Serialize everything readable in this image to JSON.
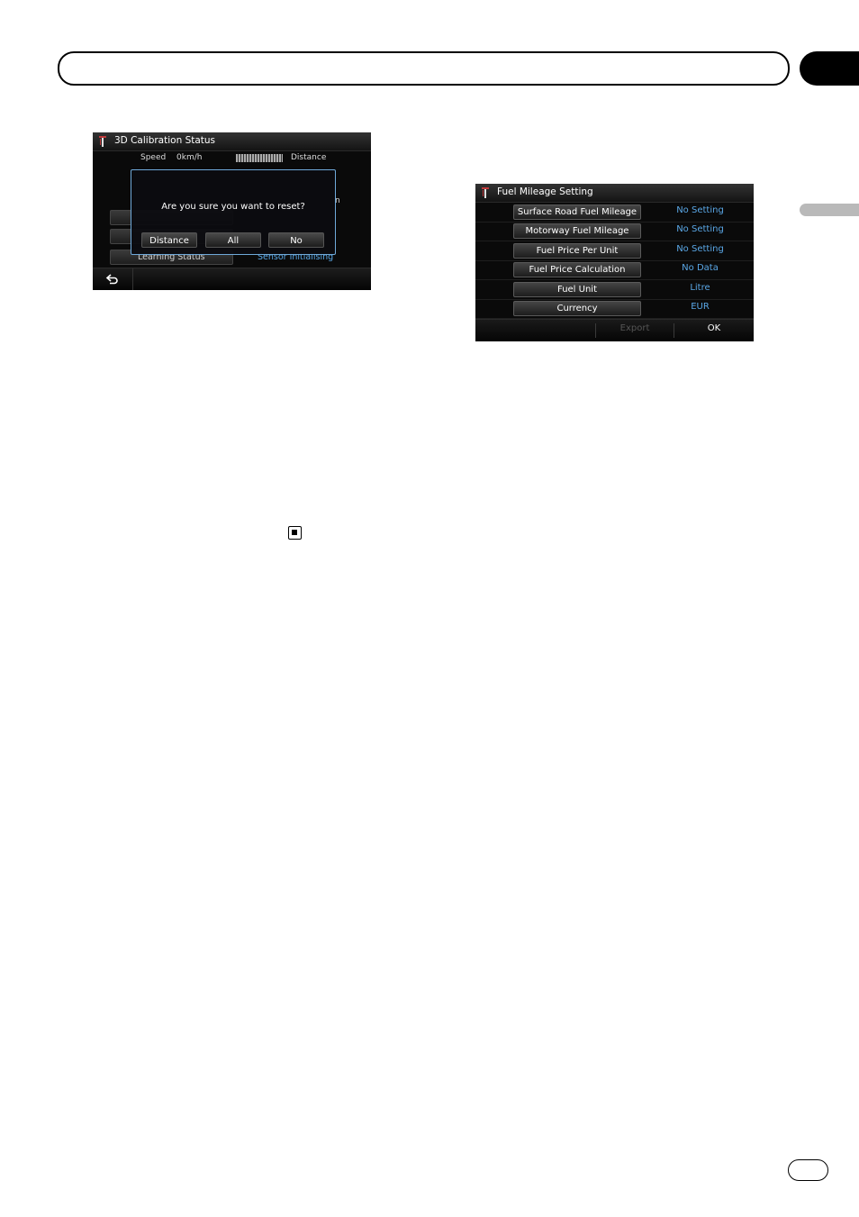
{
  "calibration_screen": {
    "title": "3D Calibration Status",
    "speed_label": "Speed",
    "speed_value": "0km/h",
    "distance_label": "Distance",
    "cut_text": "n",
    "learning_status_label": "Learning Status",
    "learning_status_value": "Sensor Initialising",
    "dialog": {
      "message": "Are you sure you want to reset?",
      "buttons": [
        "Distance",
        "All",
        "No"
      ]
    },
    "back_icon": "back-arrow-icon"
  },
  "fuel_screen": {
    "title": "Fuel Mileage Setting",
    "rows": [
      {
        "label": "Surface Road Fuel Mileage",
        "value": "No Setting"
      },
      {
        "label": "Motorway Fuel Mileage",
        "value": "No Setting"
      },
      {
        "label": "Fuel Price Per Unit",
        "value": "No Setting"
      },
      {
        "label": "Fuel Price Calculation",
        "value": "No Data"
      },
      {
        "label": "Fuel Unit",
        "value": "Litre"
      },
      {
        "label": "Currency",
        "value": "EUR"
      }
    ],
    "export_label": "Export",
    "ok_label": "OK"
  },
  "colors": {
    "value_blue": "#5aa7e6",
    "dialog_border": "#6fa9d9"
  }
}
